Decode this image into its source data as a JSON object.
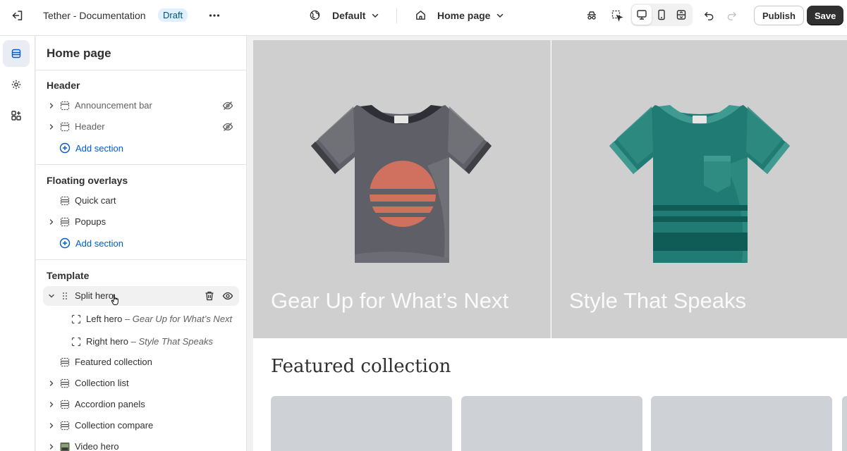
{
  "topbar": {
    "exit_icon": "exit-icon",
    "store_title": "Tether - Documentation",
    "status_badge": "Draft",
    "more_icon": "more-horizontal-icon",
    "theme_selector": "Default",
    "page_selector": "Home page",
    "publish_label": "Publish",
    "save_label": "Save"
  },
  "sidebar": {
    "title": "Home page",
    "groups": {
      "header": {
        "title": "Header",
        "items": [
          {
            "label": "Announcement bar",
            "hidden": true
          },
          {
            "label": "Header",
            "hidden": true
          }
        ],
        "add_label": "Add section"
      },
      "overlays": {
        "title": "Floating overlays",
        "items": [
          {
            "label": "Quick cart"
          },
          {
            "label": "Popups"
          }
        ],
        "add_label": "Add section"
      },
      "template": {
        "title": "Template",
        "items": [
          {
            "label": "Split hero"
          },
          {
            "label": "Left hero",
            "sub": "– Gear Up for What’s Next"
          },
          {
            "label": "Right hero",
            "sub": "– Style That Speaks"
          },
          {
            "label": "Featured collection"
          },
          {
            "label": "Collection list"
          },
          {
            "label": "Accordion panels"
          },
          {
            "label": "Collection compare"
          },
          {
            "label": "Video hero"
          }
        ]
      }
    }
  },
  "preview": {
    "hero_left_heading": "Gear Up for What’s Next",
    "hero_right_heading": "Style That Speaks",
    "featured_title": "Featured collection"
  },
  "colors": {
    "accent": "#005bd3",
    "save_bg": "#303030",
    "badge_bg": "#e0f0ff",
    "hero_bg": "#cfcfcf",
    "shirt_grey": "#5f6067",
    "shirt_teal": "#1f7b73",
    "stripe_orange": "#d0705e"
  }
}
